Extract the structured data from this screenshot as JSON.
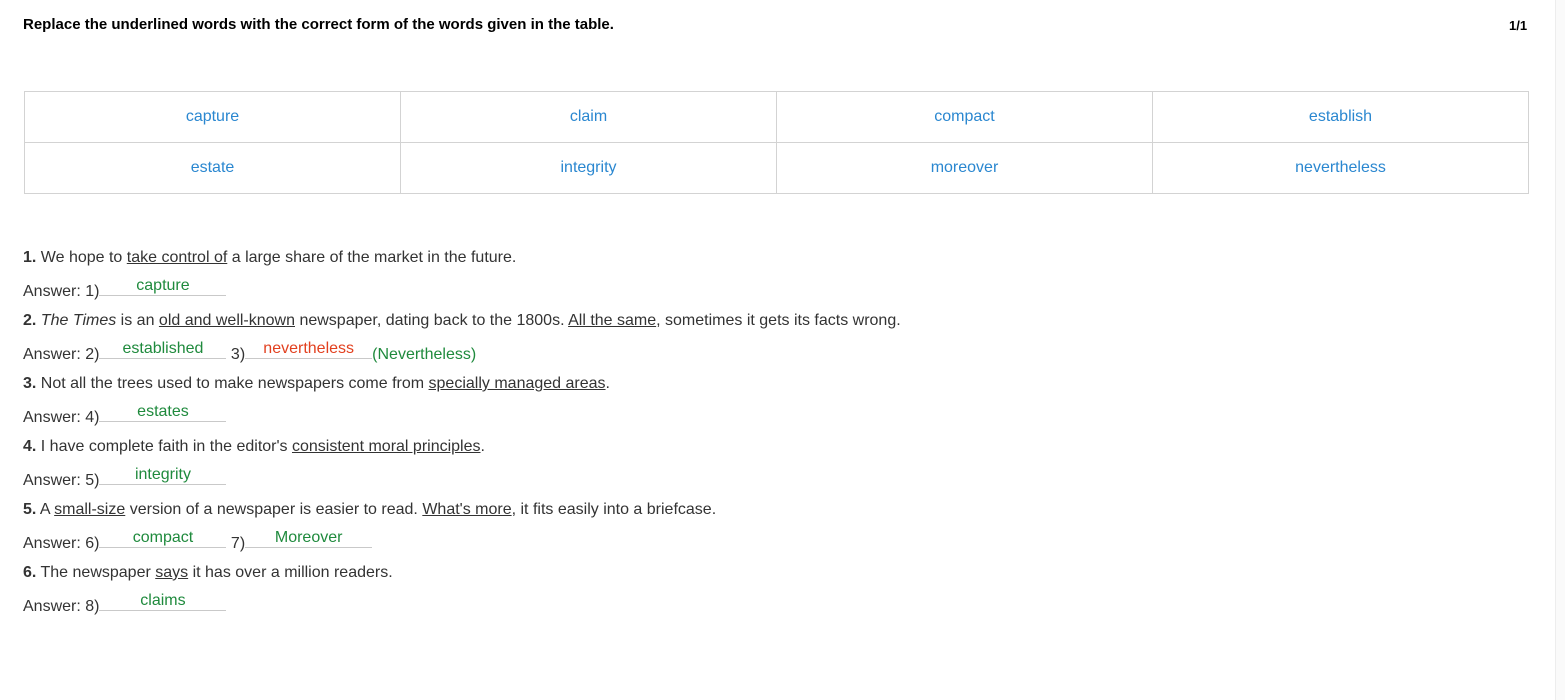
{
  "header": {
    "instruction": "Replace the underlined words with the correct form of the words given in the table.",
    "pager": "1/1"
  },
  "word_table": [
    [
      "capture",
      "claim",
      "compact",
      "establish"
    ],
    [
      "estate",
      "integrity",
      "moreover",
      "nevertheless"
    ]
  ],
  "questions": [
    {
      "num": "1.",
      "pre": " We hope to ",
      "u1": "take control of",
      "post": " a large share of the market in the future."
    },
    {
      "num": "2.",
      "italic": "The Times",
      "pre": " is an ",
      "u1": "old and well-known",
      "mid": " newspaper, dating back to the 1800s. ",
      "u2": "All the same",
      "post": ", sometimes it gets its facts wrong."
    },
    {
      "num": "3.",
      "pre": " Not all the trees used to make newspapers come from ",
      "u1": "specially managed areas",
      "post": "."
    },
    {
      "num": "4.",
      "pre": " I have complete faith in the editor's ",
      "u1": "consistent moral principles",
      "post": "."
    },
    {
      "num": "5.",
      "pre": " A ",
      "u1": "small-size",
      "mid": " version of a newspaper is easier to read. ",
      "u2": "What's more",
      "post": ", it fits easily into a briefcase."
    },
    {
      "num": "6.",
      "pre": " The newspaper ",
      "u1": "says",
      "post": " it has over a million readers."
    }
  ],
  "answers": [
    {
      "prefix": "Answer: 1)",
      "value": "capture",
      "status": "correct"
    },
    {
      "prefix": "Answer: 2)",
      "value": "established",
      "status": "correct",
      "prefix2": "3)",
      "value2": "nevertheless",
      "status2": "wrong",
      "correction2": "(Nevertheless)"
    },
    {
      "prefix": "Answer: 4)",
      "value": "estates",
      "status": "correct"
    },
    {
      "prefix": "Answer: 5)",
      "value": "integrity",
      "status": "correct"
    },
    {
      "prefix": "Answer: 6)",
      "value": "compact",
      "status": "correct",
      "prefix2": "7)",
      "value2": "Moreover",
      "status2": "correct"
    },
    {
      "prefix": "Answer: 8)",
      "value": "claims",
      "status": "correct"
    }
  ],
  "colors": {
    "table_word": "#2a87d0",
    "correct": "#1f8a3d",
    "wrong": "#e2401f"
  }
}
